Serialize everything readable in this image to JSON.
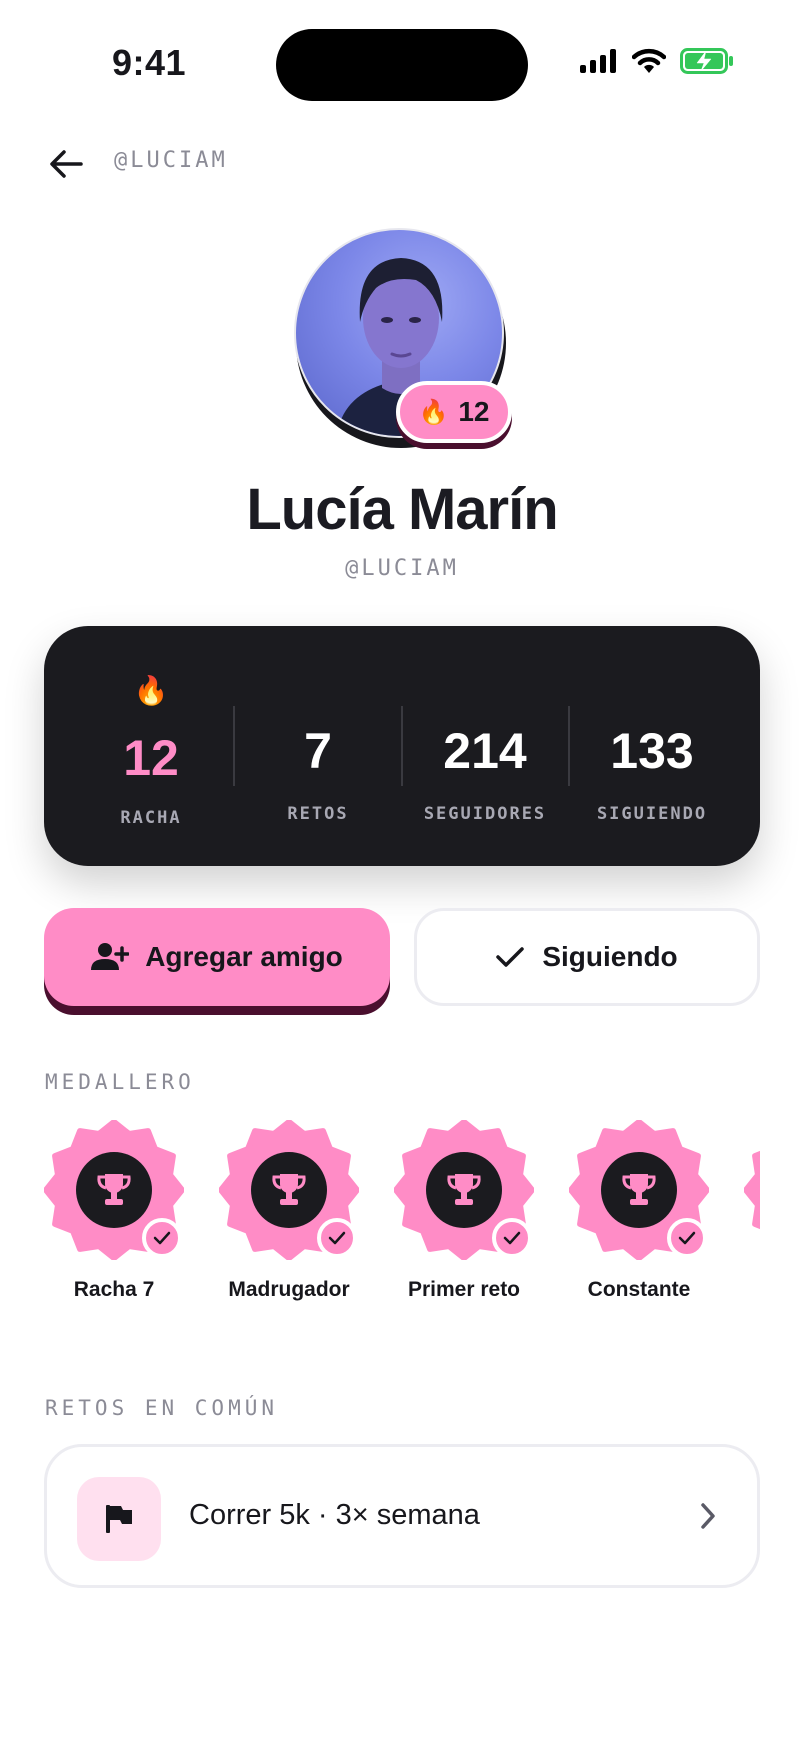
{
  "status_bar": {
    "time": "9:41"
  },
  "header": {
    "handle": "@LUCIAM"
  },
  "profile": {
    "name": "Lucía Marín",
    "handle": "@LUCIAM",
    "streak_badge": {
      "emoji": "🔥",
      "value": "12"
    }
  },
  "stats": [
    {
      "emoji": "🔥",
      "value": "12",
      "label": "RACHA"
    },
    {
      "value": "7",
      "label": "RETOS"
    },
    {
      "value": "214",
      "label": "SEGUIDORES"
    },
    {
      "value": "133",
      "label": "SIGUIENDO"
    }
  ],
  "actions": {
    "add_friend": {
      "label": "Agregar amigo",
      "icon": "person-add-icon"
    },
    "following": {
      "label": "Siguiendo",
      "icon": "check-icon"
    }
  },
  "medals": {
    "title": "MEDALLERO",
    "items": [
      {
        "label": "Racha 7",
        "icon": "trophy-icon",
        "earned": true
      },
      {
        "label": "Madrugador",
        "icon": "trophy-icon",
        "earned": true
      },
      {
        "label": "Primer reto",
        "icon": "trophy-icon",
        "earned": true
      },
      {
        "label": "Constante",
        "icon": "trophy-icon",
        "earned": true
      }
    ]
  },
  "common_challenges": {
    "title": "RETOS EN COMÚN",
    "items": [
      {
        "label": "Correr 5k · 3× semana",
        "icon": "flag-icon"
      }
    ]
  },
  "colors": {
    "accent": "#ff8cc6",
    "accent_shadow": "#4a0f2e",
    "dark_card": "#1b1b1f",
    "muted_text": "#8b8b96"
  }
}
